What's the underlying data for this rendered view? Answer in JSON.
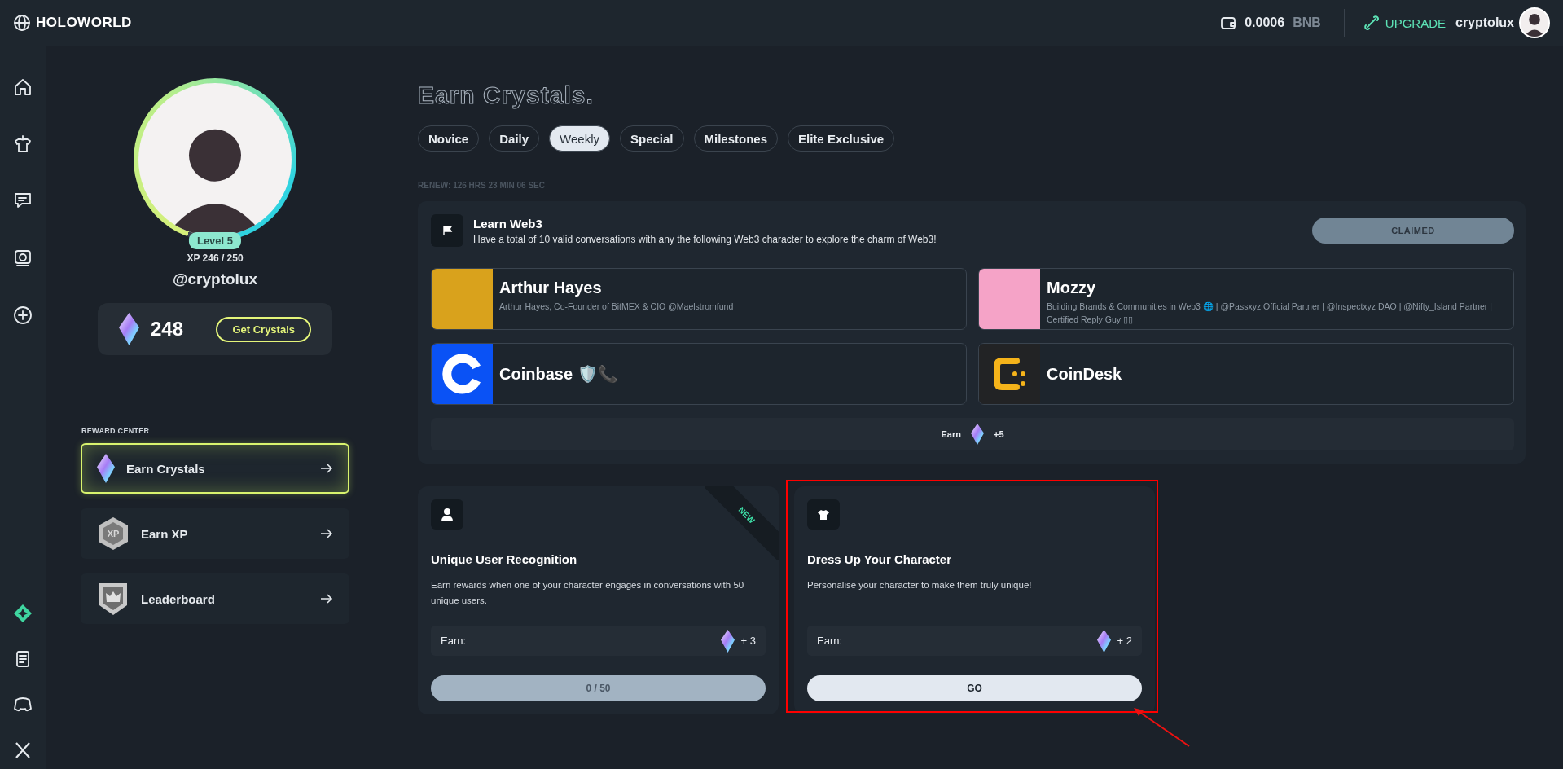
{
  "brand": {
    "name": "HOLOWORLD"
  },
  "wallet": {
    "amount": "0.0006",
    "currency": "BNB"
  },
  "upgrade": {
    "label": "UPGRADE"
  },
  "user": {
    "name": "cryptolux"
  },
  "profile": {
    "level_label": "Level 5",
    "level": 0.98,
    "xp": "XP 246 / 250",
    "handle": "@cryptolux",
    "crystals": "248",
    "get_button": "Get Crystals"
  },
  "reward_center": {
    "heading": "REWARD CENTER",
    "items": [
      {
        "label": "Earn Crystals",
        "kind": "crystal",
        "selected": true
      },
      {
        "label": "Earn XP",
        "kind": "xp",
        "badge": "XP",
        "selected": false
      },
      {
        "label": "Leaderboard",
        "kind": "leaderboard",
        "selected": false
      }
    ]
  },
  "page_title": "Earn Crystals.",
  "tabs": [
    {
      "label": "Novice",
      "selected": false
    },
    {
      "label": "Daily",
      "selected": false
    },
    {
      "label": "Weekly",
      "selected": true
    },
    {
      "label": "Special",
      "selected": false
    },
    {
      "label": "Milestones",
      "selected": false
    },
    {
      "label": "Elite Exclusive",
      "selected": false
    }
  ],
  "renew": "RENEW: 126 HRS 23 MIN 06 SEC",
  "task": {
    "title": "Learn Web3",
    "description": "Have a total of 10 valid conversations with any the following Web3 character to explore the charm of Web3!",
    "status": "CLAIMED",
    "characters": [
      {
        "name": "Arthur Hayes",
        "bio": "Arthur Hayes, Co-Founder of BitMEX & CIO @Maelstromfund",
        "kind": "portrait"
      },
      {
        "name": "Mozzy",
        "bio": "Building Brands & Communities in Web3 🌐 | @Passxyz Official Partner | @Inspectxyz DAO | @Nifty_Island Partner | Certified Reply Guy ▯▯",
        "kind": "cartoon"
      },
      {
        "name": "Coinbase 🛡️📞",
        "kind": "coinbase"
      },
      {
        "name": "CoinDesk",
        "kind": "coindesk"
      }
    ],
    "earn_label": "Earn",
    "earn_amount": "+5"
  },
  "cards": [
    {
      "kind": "user",
      "title": "Unique User Recognition",
      "description": "Earn rewards when one of your character engages in conversations with 50 unique users.",
      "earn_label": "Earn:",
      "amount": "+ 3",
      "ribbon": "NEW",
      "highlighted": false,
      "action": {
        "kind": "progress",
        "label": "0 / 50"
      }
    },
    {
      "kind": "outfit",
      "title": "Dress Up Your Character",
      "description": "Personalise your character to make them truly unique!",
      "earn_label": "Earn:",
      "amount": "+ 2",
      "highlighted": true,
      "action": {
        "kind": "button",
        "label": "GO"
      }
    }
  ]
}
